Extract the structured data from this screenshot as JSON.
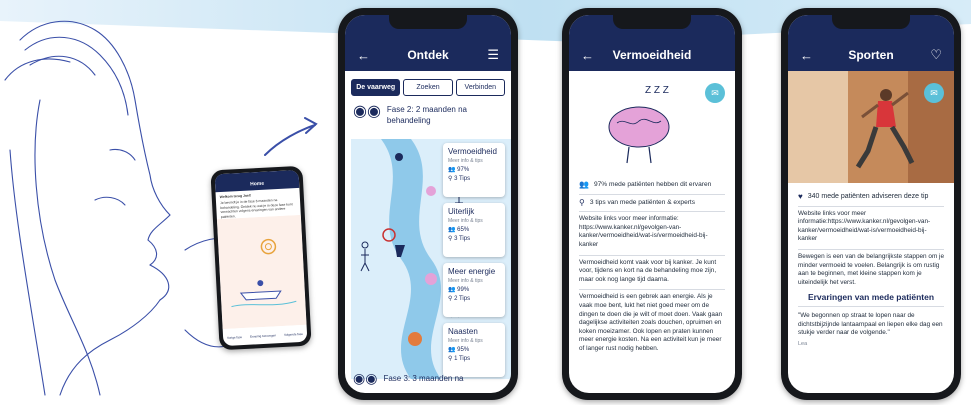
{
  "colors": {
    "navy": "#1b2a5c",
    "teal": "#5bc0d8",
    "river": "#dbeefa",
    "sketch": "#3a4fa8"
  },
  "small_phone": {
    "title": "Home",
    "welcome": "Welkom terug Joel!",
    "intro": "Je bevindt je in de fase 6 maanden na behandeling. Ontdek nu wat je in deze fase kunt verwachten volgens ervaringen van andere patiënten.",
    "nav": [
      "Vorige fase",
      "Ervaring toevoegen",
      "Volgende fase"
    ]
  },
  "phone1": {
    "title": "Ontdek",
    "tabs": [
      "De vaarweg",
      "Zoeken",
      "Verbinden"
    ],
    "phase": "Fase 2: 2 maanden na behandeling",
    "cards": [
      {
        "title": "Vermoeidheid",
        "sub": "Meer info & tips",
        "pct": "97%",
        "tips": "3 Tips"
      },
      {
        "title": "Uiterlijk",
        "sub": "Meer info & tips",
        "pct": "65%",
        "tips": "3 Tips"
      },
      {
        "title": "Meer energie",
        "sub": "Meer info & tips",
        "pct": "99%",
        "tips": "2 Tips"
      },
      {
        "title": "Naasten",
        "sub": "Meer info & tips",
        "pct": "95%",
        "tips": "1 Tips"
      }
    ],
    "next_phase": "Fase 3: 3 maanden na"
  },
  "phone2": {
    "title": "Vermoeidheid",
    "zzz": "Z Z Z",
    "stat1": "97% mede patiënten hebben dit ervaren",
    "stat2": "3 tips van mede patiënten & experts",
    "p1": "Website links voor meer informatie: https://www.kanker.nl/gevolgen-van-kanker/vermoeidheid/wat-is/vermoeidheid-bij-kanker",
    "p2": "Vermoeidheid komt vaak voor bij kanker. Je kunt voor, tijdens en kort na de behandeling moe zijn, maar ook nog lange tijd daarna.",
    "p3": "Vermoeidheid is een gebrek aan energie. Als je vaak moe bent, lukt het niet goed meer om de dingen te doen die je wilt of moet doen. Vaak gaan dagelijkse activiteiten zoals douchen, opruimen en koken moeizamer. Ook lopen en praten kunnen meer energie kosten. Na een activiteit kun je meer of langer rust nodig hebben."
  },
  "phone3": {
    "title": "Sporten",
    "stat": "340 mede patiënten adviseren deze tip",
    "p1": "Website links voor meer informatie:https://www.kanker.nl/gevolgen-van-kanker/vermoeidheid/wat-is/vermoeidheid-bij-kanker",
    "p2": "Bewegen is een van de belangrijkste stappen om je minder vermoeid te voelen. Belangrijk is om rustig aan te beginnen, met kleine stappen kom je uiteindelijk het verst.",
    "section": "Ervaringen van mede patiënten",
    "quote": "\"We begonnen op straat te lopen naar de dichtstbijzijnde lantaarnpaal en liepen elke dag een stukje verder naar de volgende.\"",
    "author": "Lea"
  }
}
